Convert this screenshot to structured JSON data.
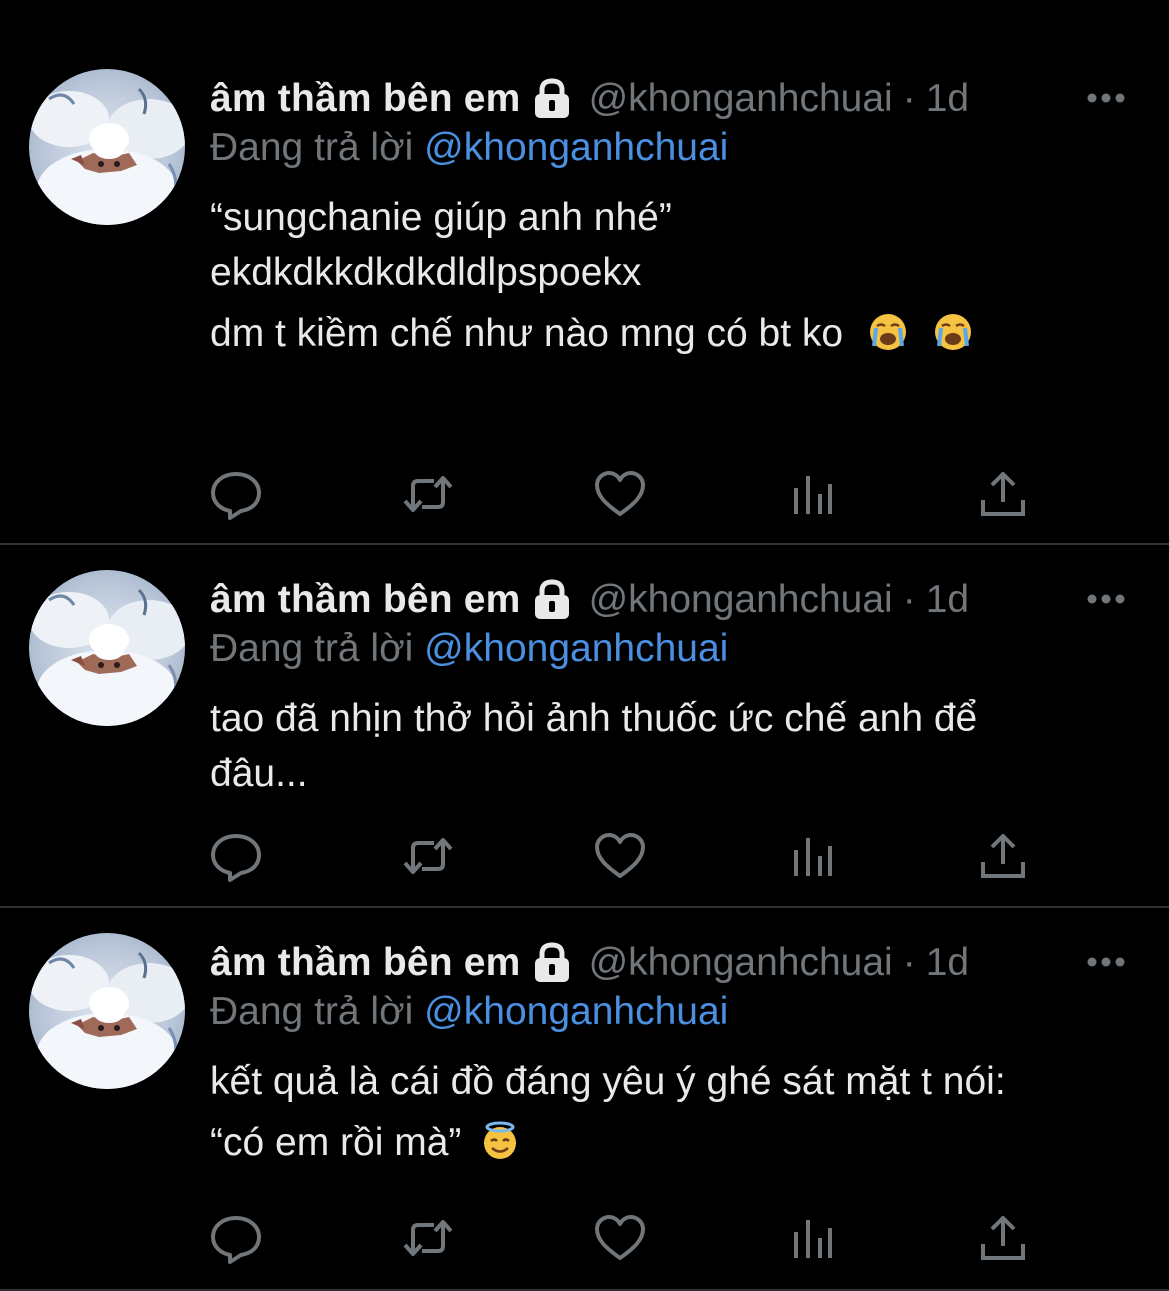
{
  "colors": {
    "background": "#000000",
    "text": "#e7e9ea",
    "secondary": "#71767b",
    "link": "#4a8fe0",
    "divider": "#2f3336"
  },
  "tweets": [
    {
      "display_name": "âm thầm bên em",
      "handle": "@khonganhchuai",
      "separator": "·",
      "time": "1d",
      "reply_prefix": "Đang trả lời",
      "reply_handle": "@khonganhchuai",
      "lines": [
        "“sungchanie giúp anh nhé”",
        "ekdkdkkdkdkdldlpspoekx",
        "dm t kiềm chế như nào mng có bt ko"
      ],
      "emoji": [
        "loudly-crying-face",
        "loudly-crying-face"
      ]
    },
    {
      "display_name": "âm thầm bên em",
      "handle": "@khonganhchuai",
      "separator": "·",
      "time": "1d",
      "reply_prefix": "Đang trả lời",
      "reply_handle": "@khonganhchuai",
      "lines": [
        "tao đã nhịn thở hỏi ảnh thuốc ức chế anh để",
        "đâu..."
      ]
    },
    {
      "display_name": "âm thầm bên em",
      "handle": "@khonganhchuai",
      "separator": "·",
      "time": "1d",
      "reply_prefix": "Đang trả lời",
      "reply_handle": "@khonganhchuai",
      "lines": [
        "kết quả là cái đồ đáng yêu ý ghé sát mặt t nói:",
        "“có em rồi mà”"
      ],
      "emoji": [
        "smiling-face-with-halo"
      ]
    }
  ],
  "icons": {
    "lock": "lock-icon",
    "more": "more-icon",
    "reply": "reply-icon",
    "retweet": "retweet-icon",
    "like": "like-icon",
    "views": "views-icon",
    "share": "share-icon"
  }
}
